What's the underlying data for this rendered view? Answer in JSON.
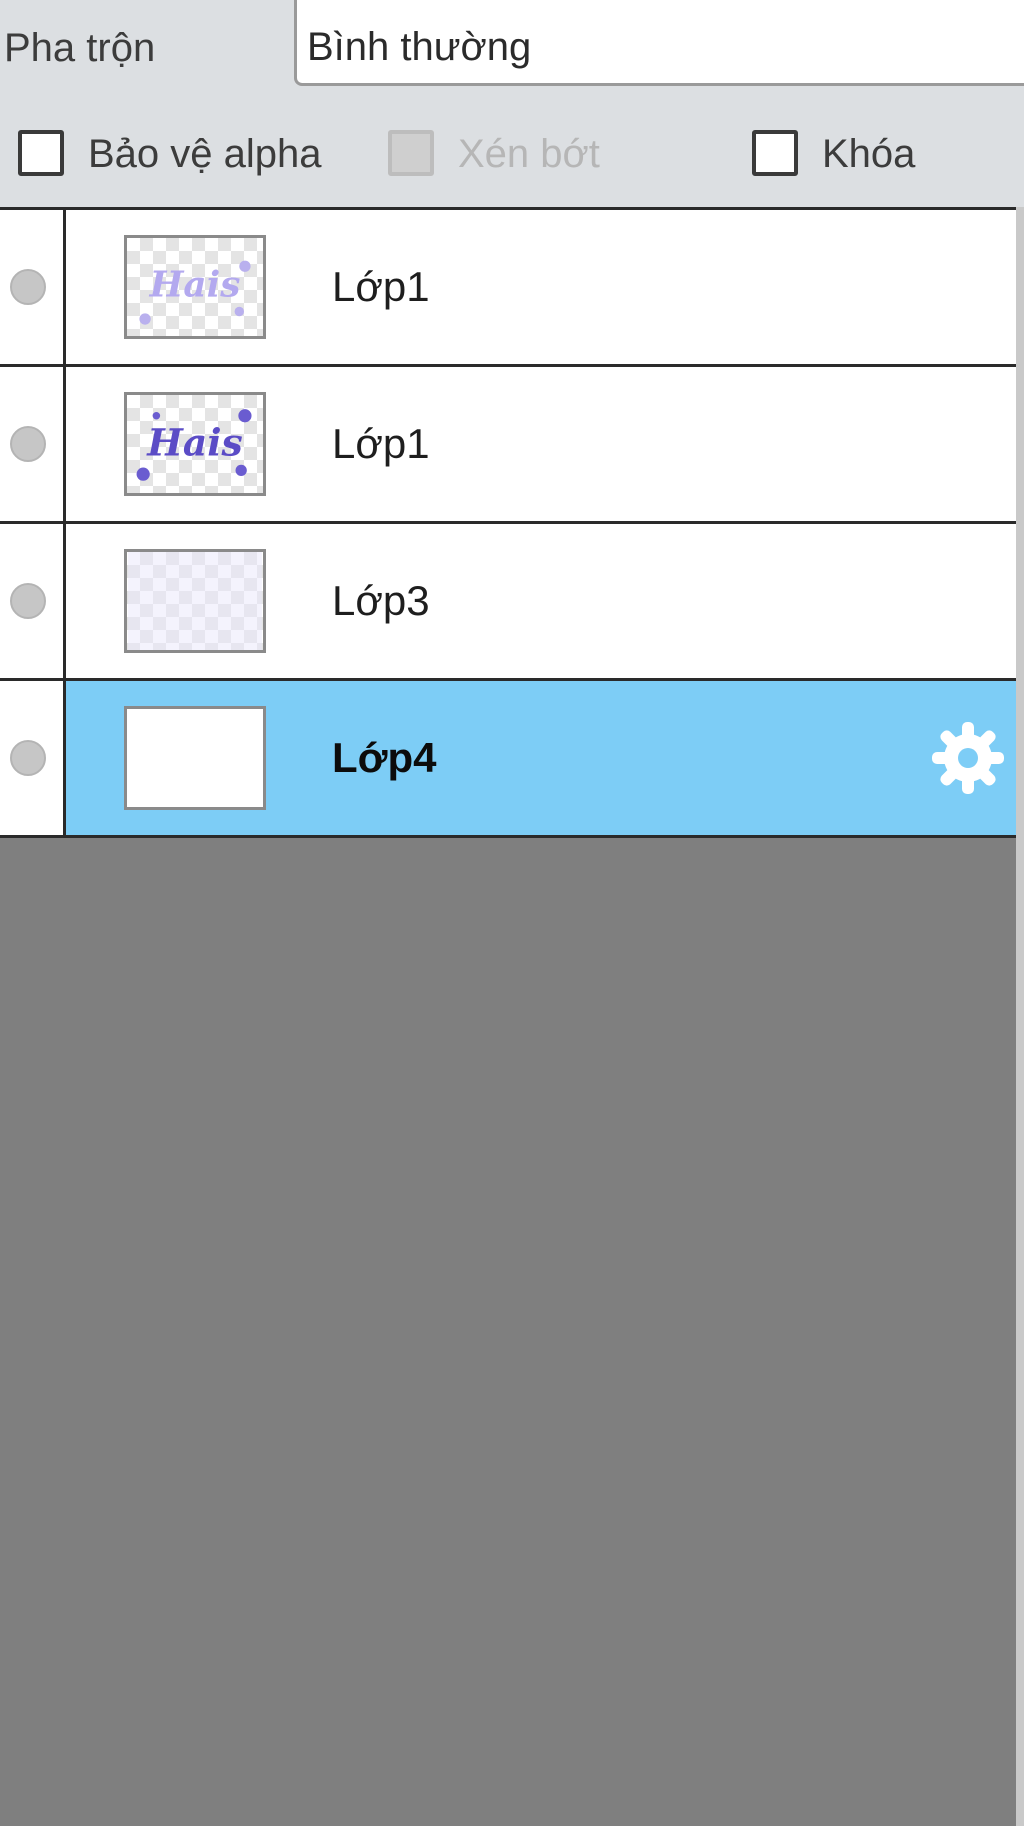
{
  "blend": {
    "label": "Pha trộn",
    "value": "Bình thường"
  },
  "options": {
    "protect_alpha": {
      "label": "Bảo vệ alpha",
      "checked": false,
      "enabled": true
    },
    "clip": {
      "label": "Xén bớt",
      "checked": false,
      "enabled": false
    },
    "lock": {
      "label": "Khóa",
      "checked": false,
      "enabled": true
    }
  },
  "layers": [
    {
      "name": "Lớp1",
      "thumbnail_text": "Hais",
      "selected": false
    },
    {
      "name": "Lớp1",
      "thumbnail_text": "Hais",
      "selected": false
    },
    {
      "name": "Lớp3",
      "selected": false
    },
    {
      "name": "Lớp4",
      "selected": true
    }
  ],
  "colors": {
    "selected_row": "#7dcdf6",
    "empty_area": "#7f7f7f",
    "thumbnail_ink": "#6a5cd0"
  },
  "icons": {
    "visibility": "visibility-dot-icon",
    "settings": "gear-icon"
  }
}
